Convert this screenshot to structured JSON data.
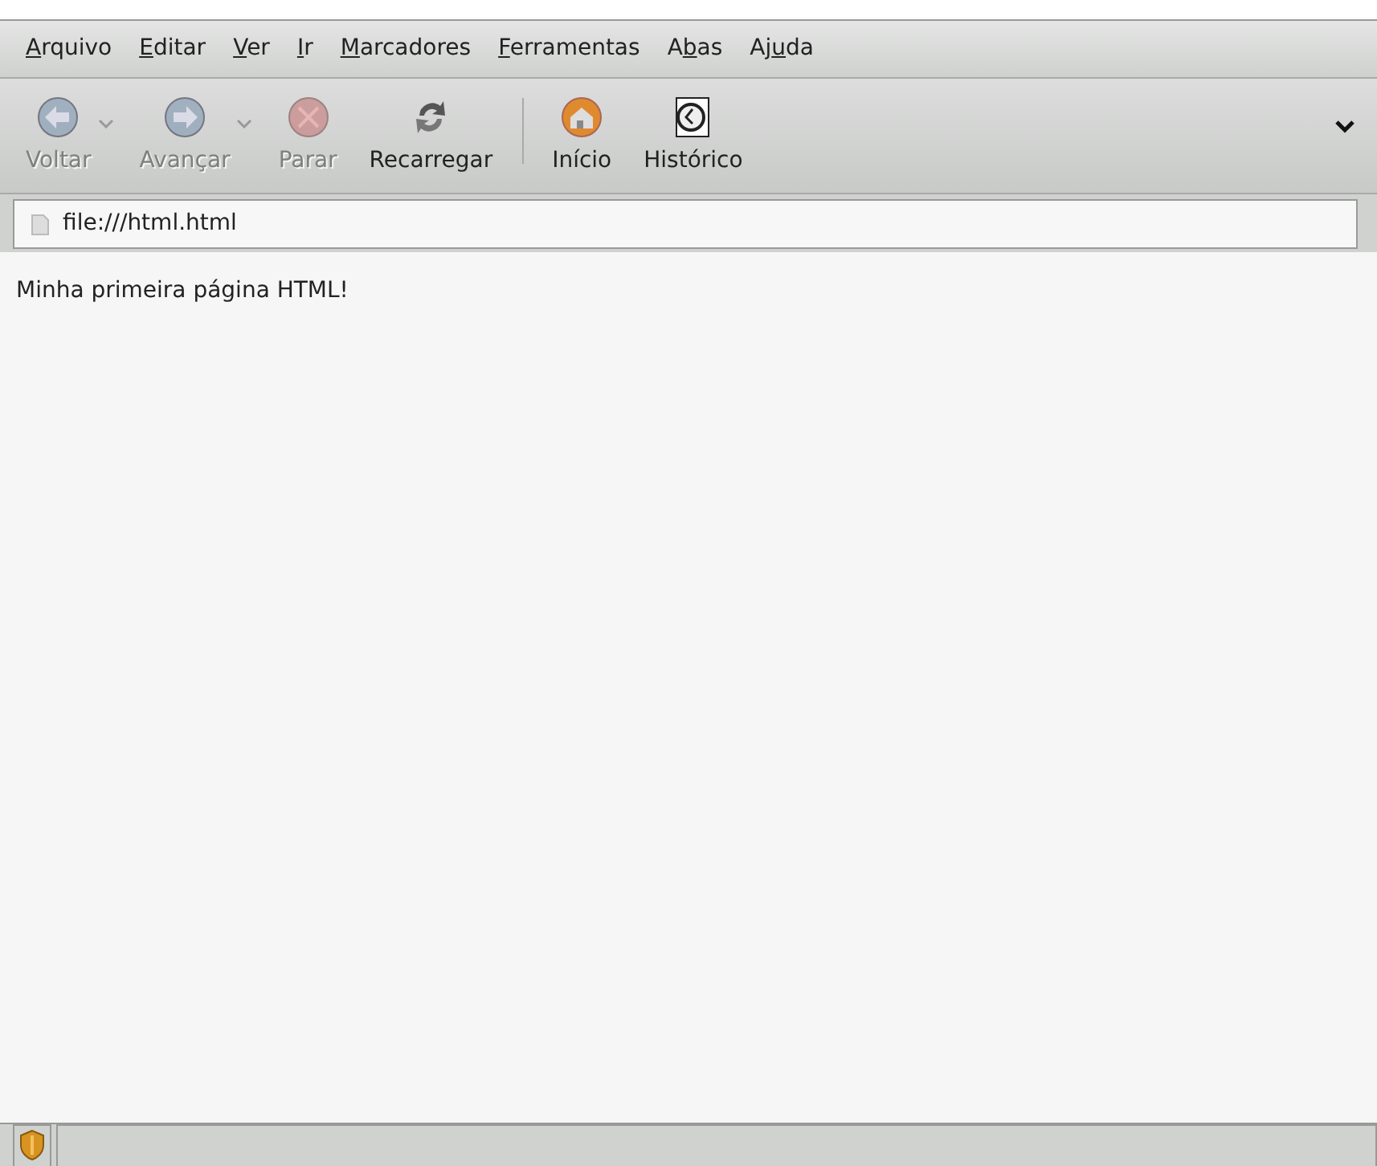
{
  "menu": [
    {
      "key": "A",
      "after": "rquivo"
    },
    {
      "key": "E",
      "after": "ditar"
    },
    {
      "key": "V",
      "after": "er"
    },
    {
      "key": "I",
      "after": "r"
    },
    {
      "key": "M",
      "after": "arcadores"
    },
    {
      "key": "F",
      "after": "erramentas"
    },
    {
      "before": "A",
      "key": "b",
      "after": "as"
    },
    {
      "before": "Aj",
      "key": "u",
      "after": "da"
    }
  ],
  "toolbar": [
    {
      "kind": "back",
      "label": "Voltar",
      "disabled": true,
      "dropdown": true
    },
    {
      "kind": "forward",
      "label": "Avançar",
      "disabled": true,
      "dropdown": true
    },
    {
      "kind": "stop",
      "label": "Parar",
      "disabled": true,
      "dropdown": false
    },
    {
      "kind": "reload",
      "label": "Recarregar",
      "disabled": false,
      "dropdown": false
    },
    {
      "kind": "separator"
    },
    {
      "kind": "home",
      "label": "Início",
      "disabled": false,
      "dropdown": false
    },
    {
      "kind": "history",
      "label": "Histórico",
      "disabled": false,
      "dropdown": false
    }
  ],
  "address": {
    "value": "file:///html.html"
  },
  "content": {
    "text": "Minha primeira página HTML!"
  }
}
